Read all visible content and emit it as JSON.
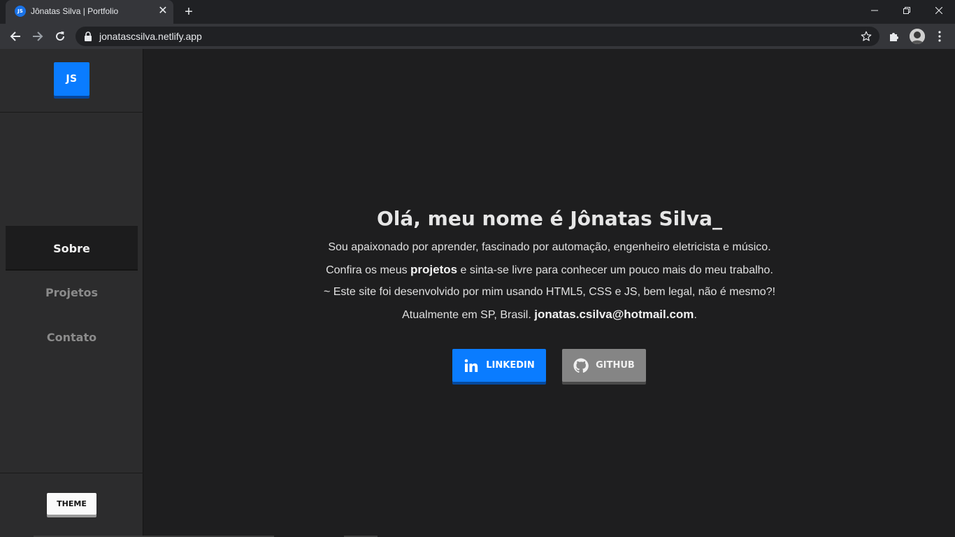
{
  "browser": {
    "tab_title": "Jônatas Silva | Portfolio",
    "favicon_text": "JS",
    "url": "jonatascsilva.netlify.app",
    "icons": {
      "tab_close": "close-icon",
      "new_tab": "plus-icon",
      "back": "arrow-left-icon",
      "forward": "arrow-right-icon",
      "reload": "reload-icon",
      "lock": "lock-icon",
      "bookmark": "star-icon",
      "extensions": "puzzle-icon",
      "profile": "avatar-icon",
      "menu": "kebab-menu-icon"
    }
  },
  "sidebar": {
    "logo": "JS",
    "nav": [
      {
        "label": "Sobre",
        "active": true
      },
      {
        "label": "Projetos",
        "active": false
      },
      {
        "label": "Contato",
        "active": false
      }
    ],
    "theme_button": "THEME"
  },
  "main": {
    "headline": "Olá, meu nome é Jônatas Silva_",
    "line1": "Sou apaixonado por aprender, fascinado por automação, engenheiro eletricista e músico.",
    "line2_pre": "Confira os meus ",
    "line2_bold": "projetos",
    "line2_post": " e sinta-se livre para conhecer um pouco mais do meu trabalho.",
    "line3": "~ Este site foi desenvolvido por mim usando HTML5, CSS e JS, bem legal, não é mesmo?!",
    "line4_pre": "Atualmente em SP, Brasil. ",
    "line4_bold": "jonatas.csilva@hotmail.com",
    "line4_post": ".",
    "buttons": {
      "linkedin": "LINKEDIN",
      "github": "GITHUB"
    }
  },
  "colors": {
    "accent_blue": "#0a7cff",
    "sidebar_bg": "#2c2c2d",
    "content_bg": "#1e1e1f",
    "github_gray": "#858585"
  }
}
